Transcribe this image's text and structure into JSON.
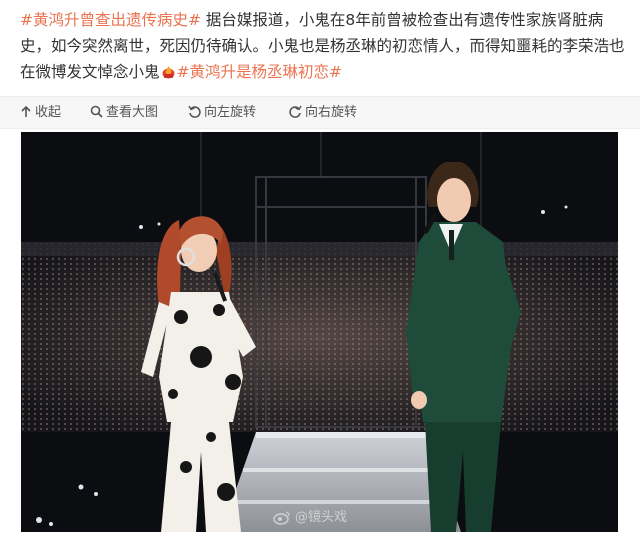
{
  "post": {
    "topic1": "#黄鸿升曾查出遗传病史#",
    "body": " 据台媒报道，小鬼在8年前曾被检查出有遗传性家族肾脏病史，如今突然离世，死因仍待确认。小鬼也是杨丞琳的初恋情人，而得知噩耗的李荣浩也在微博发文悼念小鬼",
    "emoji": "fire-emoji",
    "topic2": "#黄鸿升是杨丞琳初恋#"
  },
  "toolbar": {
    "collapse_label": "收起",
    "view_large_label": "查看大图",
    "rotate_left_label": "向左旋转",
    "rotate_right_label": "向右旋转"
  },
  "photo": {
    "watermark": "@镜头戏"
  },
  "colors": {
    "topic": "#eb7350",
    "text": "#333333",
    "toolbar_bg": "#f7f7f7"
  }
}
